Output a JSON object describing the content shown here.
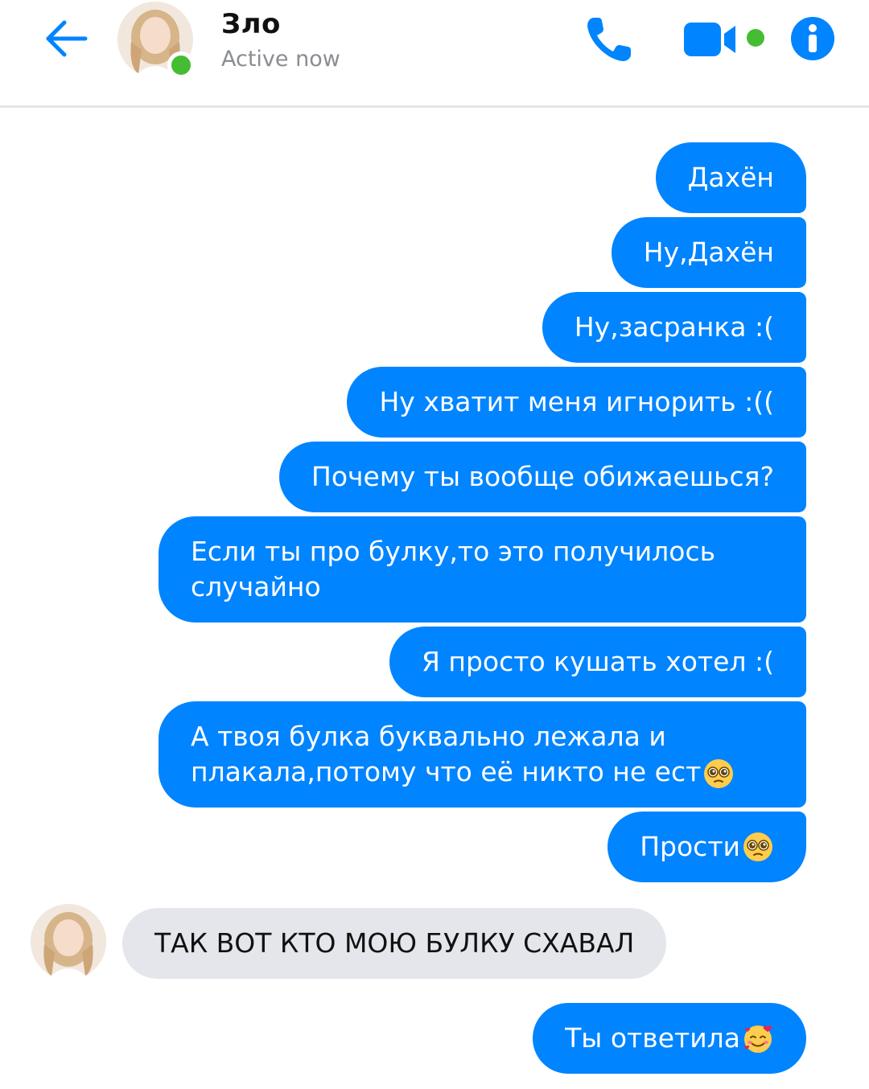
{
  "header": {
    "name": "Зло",
    "status": "Active now"
  },
  "colors": {
    "messenger_blue": "#0084ff",
    "online_green": "#45bd33",
    "received_bubble": "#e4e6eb"
  },
  "icons": {
    "back": "back-arrow-icon",
    "call": "phone-icon",
    "video": "video-camera-icon",
    "info": "info-icon",
    "emoji_pleading": "pleading-face-emoji",
    "emoji_love": "smiling-face-with-hearts-emoji"
  },
  "messages": {
    "m1": "Дахён",
    "m2": "Ну,Дахён",
    "m3": "Ну,засранка :(",
    "m4": "Ну хватит меня игнорить :((",
    "m5": "Почему ты вообще обижаешься?",
    "m6": "Если ты про булку,то это получилось случайно",
    "m7": "Я просто кушать хотел :(",
    "m8": "А твоя булка буквально лежала и плакала,потому что её никто не ест",
    "m9": "Прости",
    "r1": "ТАК ВОТ КТО МОЮ БУЛКУ СХАВАЛ",
    "m10": "Ты ответила"
  }
}
